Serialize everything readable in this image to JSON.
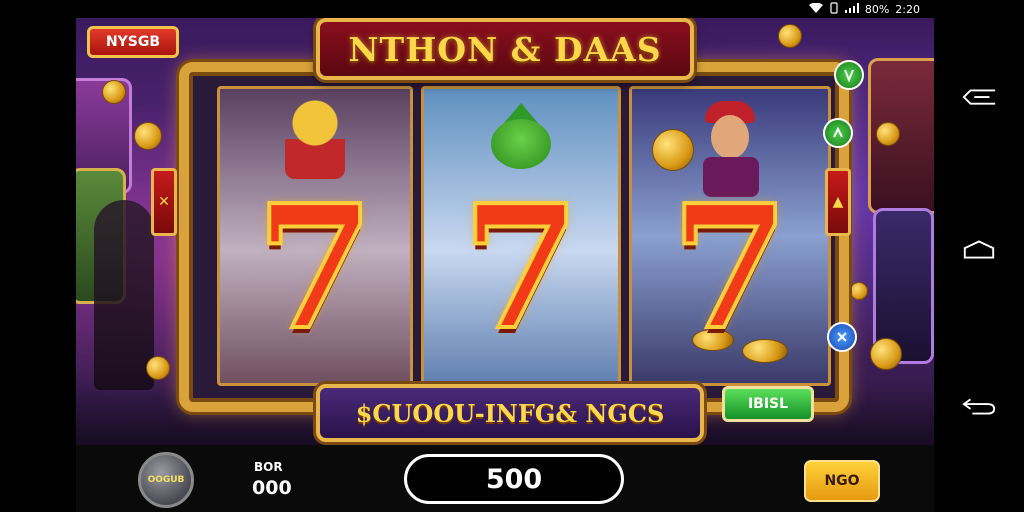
{
  "status_bar": {
    "icons": [
      "wifi-icon",
      "vibrate-icon",
      "signal-icon"
    ],
    "battery": "80%",
    "time": "2:20"
  },
  "game": {
    "title": "NTHON & DAAS",
    "top_badge": "NYSGB",
    "promo_text": "$CUOOU-INFG& NGCS",
    "green_button": "IBISL",
    "reels": [
      {
        "symbol": "7",
        "character": "golden-idol"
      },
      {
        "symbol": "7",
        "character": "green-mouse"
      },
      {
        "symbol": "7",
        "character": "coin-girl"
      }
    ]
  },
  "controls": {
    "coin_label": "OOGUB",
    "bet_label": "BOR",
    "bet_value": "000",
    "amount": "500",
    "spin_label": "NGO"
  },
  "colors": {
    "gold": "#e8b64a",
    "title_red": "#8a0f1e",
    "seven_red": "#f03a18",
    "spin_yellow": "#ffd23a",
    "green_button": "#16902a"
  }
}
